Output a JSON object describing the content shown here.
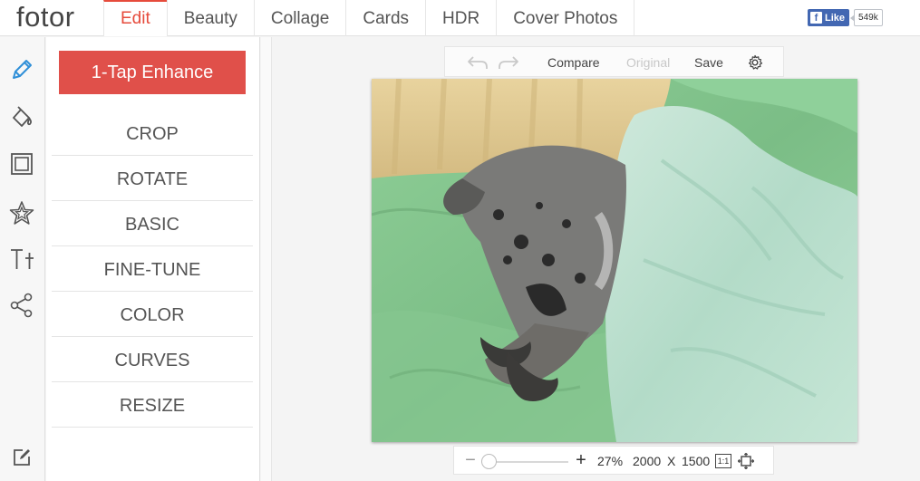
{
  "app": {
    "logo": "fotor"
  },
  "nav": {
    "tabs": [
      {
        "label": "Edit",
        "active": true
      },
      {
        "label": "Beauty"
      },
      {
        "label": "Collage"
      },
      {
        "label": "Cards"
      },
      {
        "label": "HDR"
      },
      {
        "label": "Cover Photos"
      }
    ],
    "facebook": {
      "like_label": "Like",
      "count": "549k"
    }
  },
  "rail": {
    "icons": [
      "pencil-icon",
      "paint-bucket-icon",
      "frame-icon",
      "star-icon",
      "text-icon",
      "share-icon",
      "edit-note-icon"
    ]
  },
  "panel": {
    "enhance_label": "1-Tap Enhance",
    "items": [
      "CROP",
      "ROTATE",
      "BASIC",
      "FINE-TUNE",
      "COLOR",
      "CURVES",
      "RESIZE"
    ]
  },
  "canvas_toolbar": {
    "compare_label": "Compare",
    "original_label": "Original",
    "save_label": "Save"
  },
  "zoom": {
    "percent": "27%",
    "width": "2000",
    "x_label": "X",
    "height": "1500",
    "actual_size_label": "1:1"
  },
  "colors": {
    "accent": "#e64b3c",
    "enhance": "#e0504a",
    "facebook": "#4267b2"
  }
}
